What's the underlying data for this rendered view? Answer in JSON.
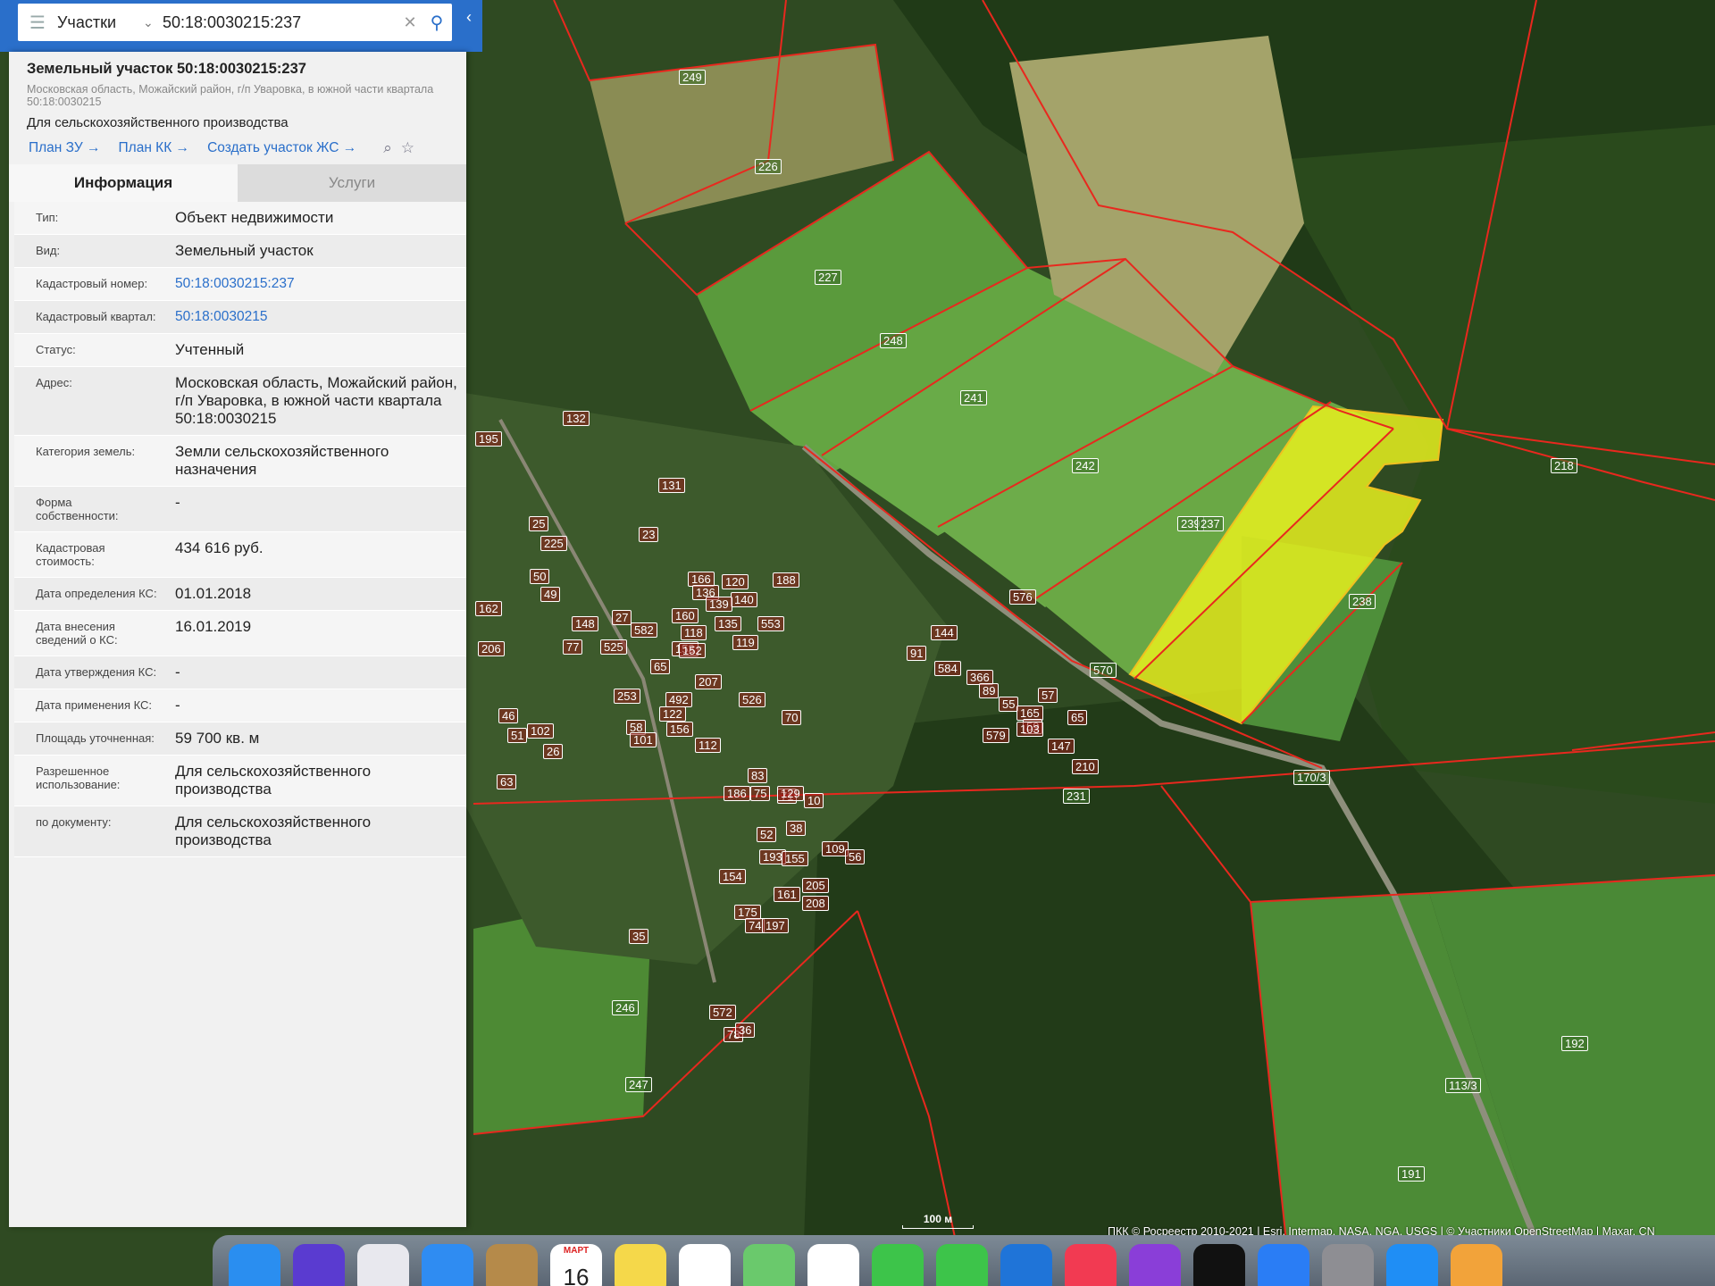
{
  "search": {
    "layer": "Участки",
    "query": "50:18:0030215:237"
  },
  "parcel": {
    "title": "Земельный участок 50:18:0030215:237",
    "address_short": "Московская область, Можайский район, г/п Уваровка, в южной части квартала 50:18:0030215",
    "purpose": "Для сельскохозяйственного производства",
    "links": [
      "План ЗУ →",
      "План КК →",
      "Создать участок ЖС →"
    ]
  },
  "tabs": [
    "Информация",
    "Услуги"
  ],
  "info_rows": [
    {
      "key": "Тип:",
      "value": "Объект недвижимости",
      "link": false
    },
    {
      "key": "Вид:",
      "value": "Земельный участок",
      "link": false
    },
    {
      "key": "Кадастровый номер:",
      "value": "50:18:0030215:237",
      "link": true
    },
    {
      "key": "Кадастровый квартал:",
      "value": "50:18:0030215",
      "link": true
    },
    {
      "key": "Статус:",
      "value": "Учтенный",
      "link": false
    },
    {
      "key": "Адрес:",
      "value": "Московская область, Можайский район, г/п Уваровка, в южной части квартала 50:18:0030215",
      "link": false
    },
    {
      "key": "Категория земель:",
      "value": "Земли сельскохозяйственного назначения",
      "link": false
    },
    {
      "key": "Форма собственности:",
      "value": "-",
      "link": false
    },
    {
      "key": "Кадастровая стоимость:",
      "value": "434 616 руб.",
      "link": false
    },
    {
      "key": "Дата определения КС:",
      "value": "01.01.2018",
      "link": false
    },
    {
      "key": "Дата внесения сведений о КС:",
      "value": "16.01.2019",
      "link": false
    },
    {
      "key": "Дата утверждения КС:",
      "value": "-",
      "link": false
    },
    {
      "key": "Дата применения КС:",
      "value": "-",
      "link": false
    },
    {
      "key": "Площадь уточненная:",
      "value": "59 700 кв. м",
      "link": false
    },
    {
      "key": "Разрешенное использование:",
      "value": "Для сельскохозяйственного производства",
      "link": false
    },
    {
      "key": "по документу:",
      "value": "Для сельскохозяйственного производства",
      "link": false
    }
  ],
  "map": {
    "scale": "100 м",
    "attribution": "ПКК © Росреестр 2010-2021 | Esri, Intermap, NASA, NGA, USGS | © Участники OpenStreetMap | Maxar, CN",
    "selected_color": "#e6f01e",
    "boundary_color": "#e8281e",
    "plot_labels": [
      "249",
      "226",
      "227",
      "248",
      "241",
      "242",
      "239",
      "237",
      "238",
      "218",
      "231",
      "246",
      "247",
      "192",
      "191",
      "113/3",
      "570",
      "170/3",
      "132",
      "195",
      "131",
      "23",
      "25",
      "225",
      "50",
      "49",
      "162",
      "206",
      "148",
      "27",
      "582",
      "77",
      "525",
      "65",
      "253",
      "492",
      "46",
      "102",
      "51",
      "26",
      "63",
      "58",
      "101",
      "122",
      "156",
      "112",
      "207",
      "526",
      "70",
      "83",
      "71",
      "10",
      "38",
      "109",
      "56",
      "52",
      "193",
      "155",
      "154",
      "161",
      "205",
      "208",
      "175",
      "74",
      "197",
      "35",
      "572",
      "78",
      "36",
      "144",
      "91",
      "584",
      "366",
      "89",
      "55",
      "165",
      "57",
      "59",
      "65",
      "147",
      "210",
      "579",
      "103",
      "576",
      "120",
      "166",
      "140",
      "136",
      "139",
      "160",
      "118",
      "153",
      "553",
      "135",
      "119",
      "188",
      "152",
      "186",
      "75",
      "129"
    ]
  },
  "dock": {
    "calendar_month": "МАРТ",
    "calendar_day": "16",
    "icons": [
      "finder-icon",
      "siri-icon",
      "launchpad-icon",
      "mail-icon",
      "contacts-icon",
      "calendar-icon",
      "notes-icon",
      "reminders-icon",
      "maps-icon",
      "photos-icon",
      "messages-icon",
      "facetime-icon",
      "keynote-icon",
      "music-icon",
      "podcasts-icon",
      "tv-icon",
      "appstore-icon",
      "settings-icon",
      "safari-icon",
      "pages-icon"
    ]
  }
}
